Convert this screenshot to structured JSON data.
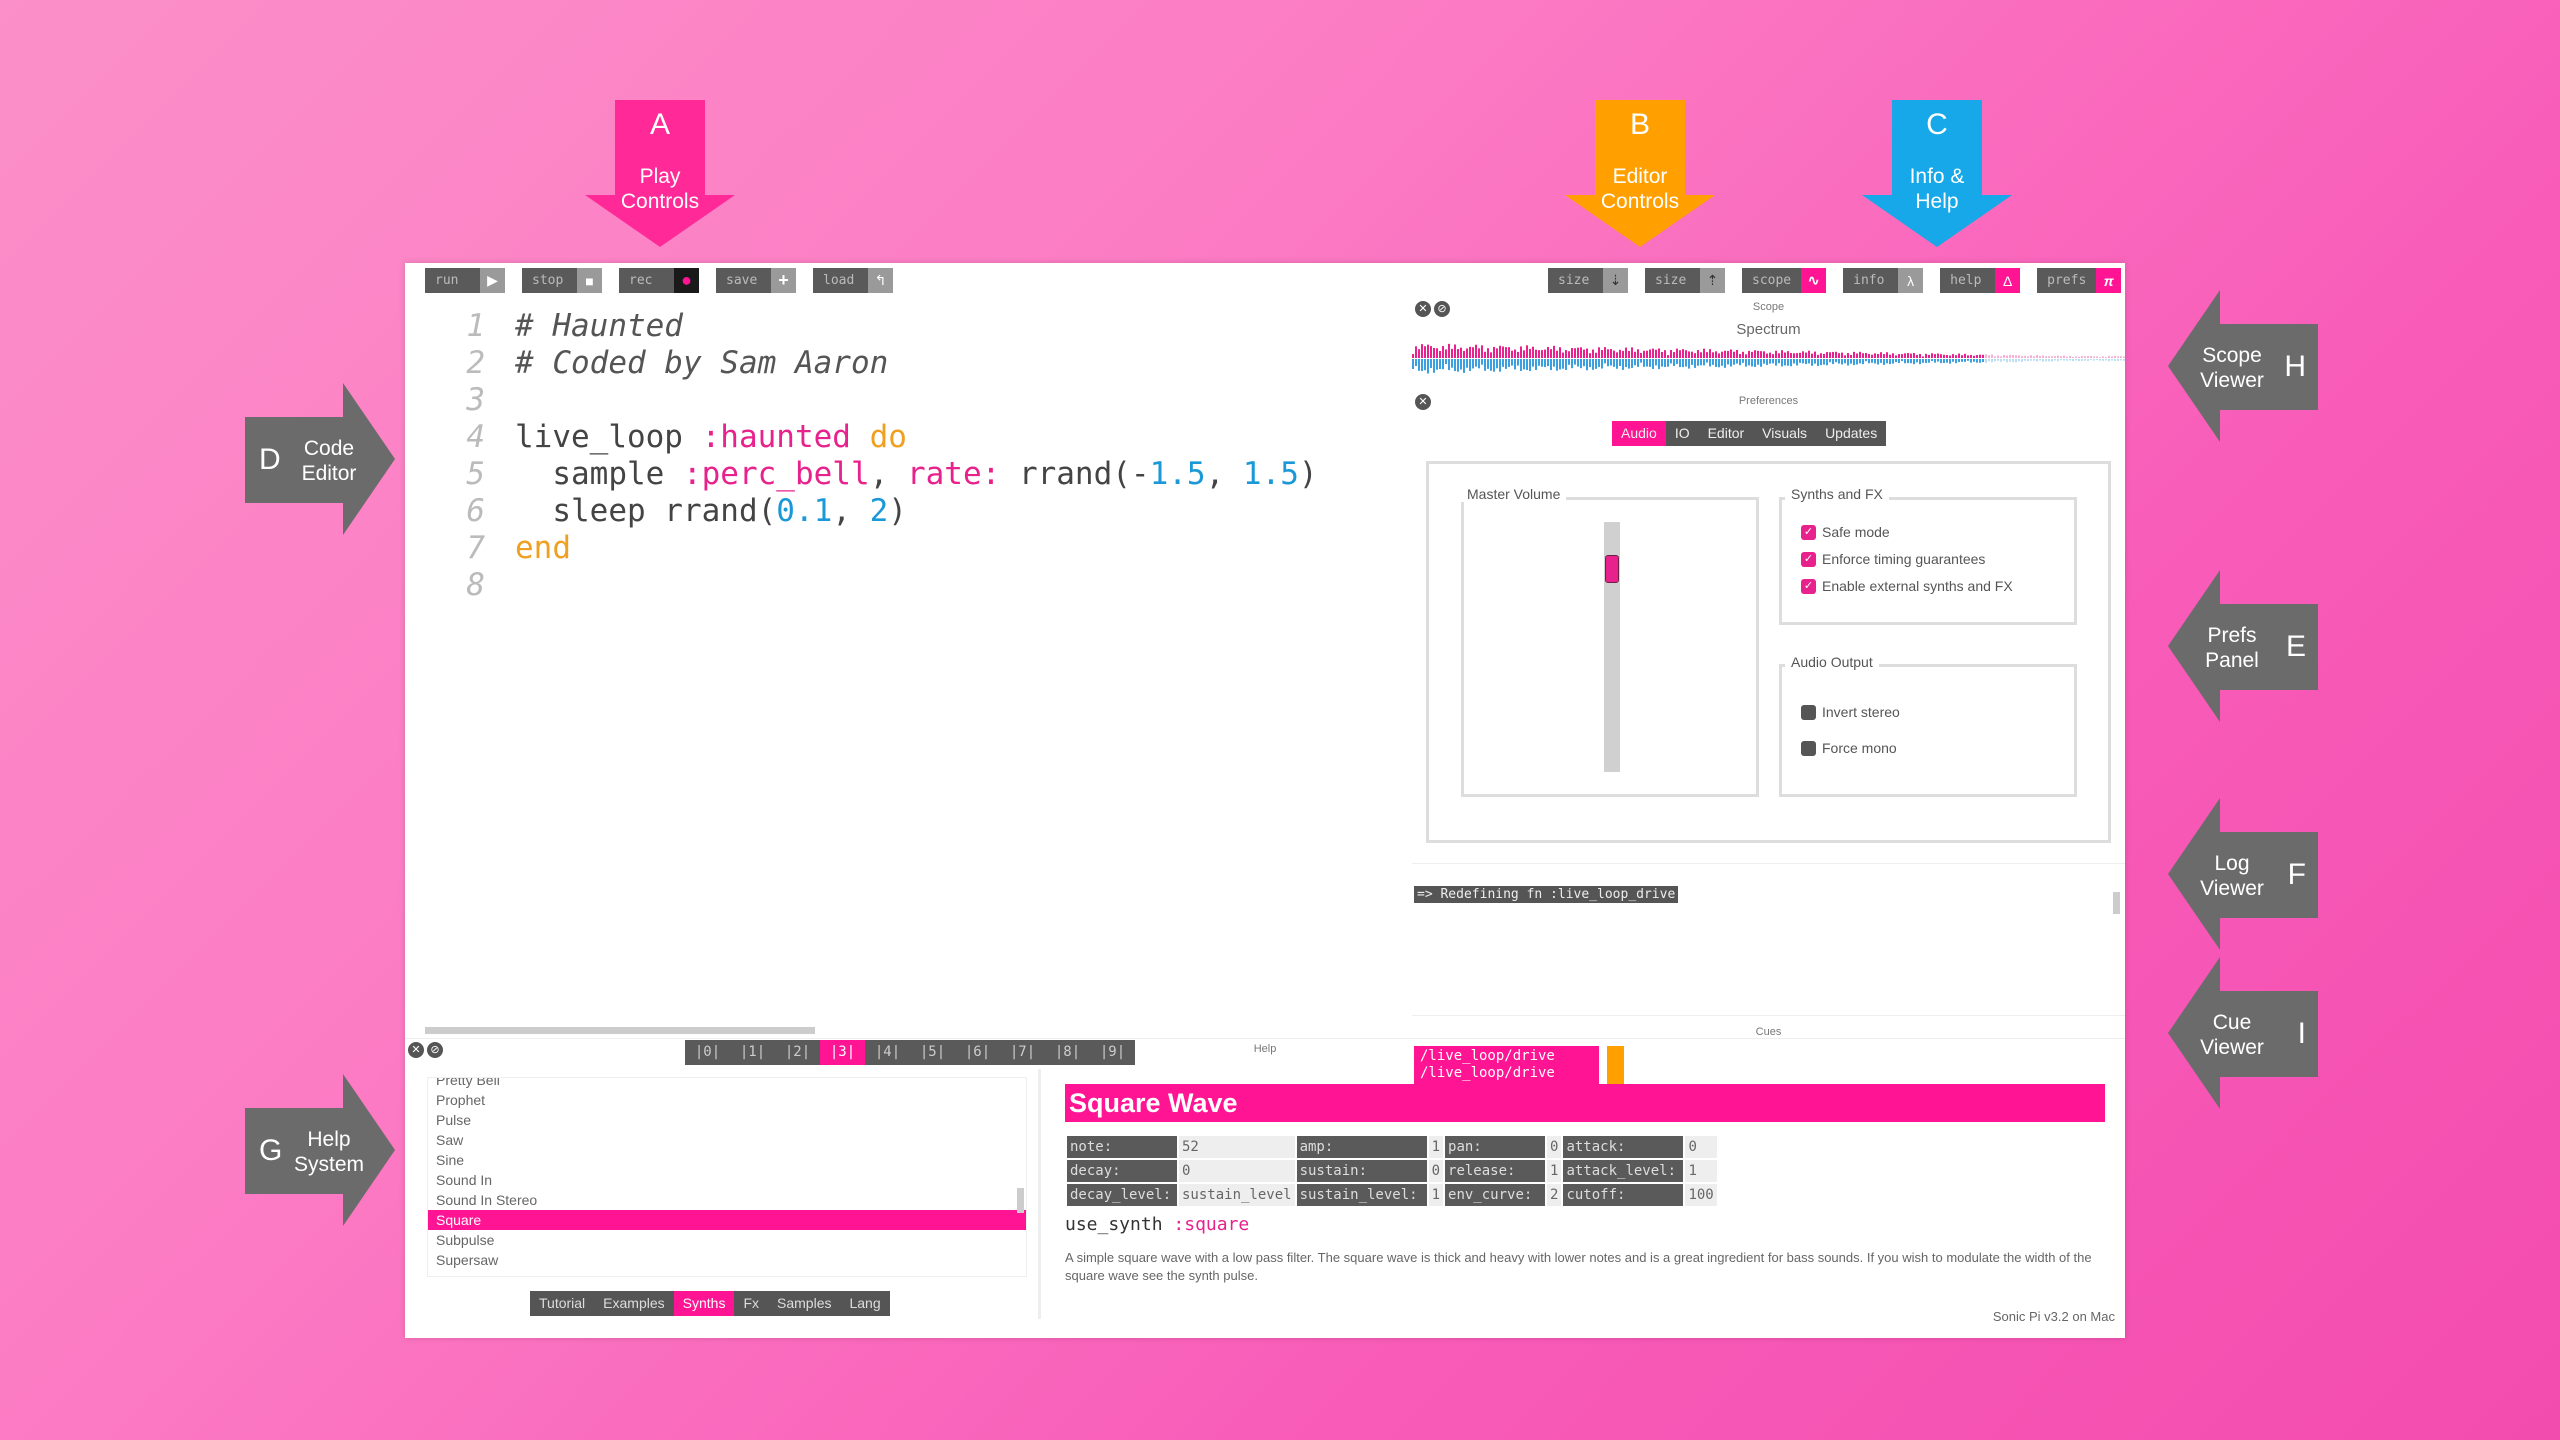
{
  "annotations": {
    "A": {
      "letter": "A",
      "label": "Play Controls",
      "color": "#ff2a98"
    },
    "B": {
      "letter": "B",
      "label": "Editor Controls",
      "color": "#ffa000"
    },
    "C": {
      "letter": "C",
      "label": "Info & Help",
      "color": "#16a8e8"
    },
    "D": {
      "letter": "D",
      "label": "Code Editor"
    },
    "E": {
      "letter": "E",
      "label": "Prefs Panel"
    },
    "F": {
      "letter": "F",
      "label": "Log Viewer"
    },
    "G": {
      "letter": "G",
      "label": "Help System"
    },
    "H": {
      "letter": "H",
      "label": "Scope Viewer"
    },
    "I": {
      "letter": "I",
      "label": "Cue Viewer"
    }
  },
  "toolbar": {
    "play": [
      {
        "label": "run",
        "icon": "play-icon",
        "glyph": "▶"
      },
      {
        "label": "stop",
        "icon": "stop-icon",
        "glyph": "■"
      },
      {
        "label": "rec",
        "icon": "record-icon",
        "glyph": "●"
      },
      {
        "label": "save",
        "icon": "plus-icon",
        "glyph": "+"
      },
      {
        "label": "load",
        "icon": "load-icon",
        "glyph": "↰"
      }
    ],
    "right": [
      {
        "label": "size",
        "icon": "size-down-icon",
        "glyph": "⇣"
      },
      {
        "label": "size",
        "icon": "size-up-icon",
        "glyph": "⇡"
      },
      {
        "label": "scope",
        "icon": "scope-icon",
        "glyph": "∿"
      },
      {
        "label": "info",
        "icon": "lambda-icon",
        "glyph": "λ"
      },
      {
        "label": "help",
        "icon": "delta-icon",
        "glyph": "Δ"
      },
      {
        "label": "prefs",
        "icon": "pi-icon",
        "glyph": "π"
      }
    ]
  },
  "editor": {
    "line_numbers": [
      "1",
      "2",
      "3",
      "4",
      "5",
      "6",
      "7",
      "8"
    ],
    "lines": {
      "l1": "# Haunted",
      "l2": "# Coded by Sam Aaron",
      "l4a": "live_loop ",
      "l4b": ":haunted",
      "l4c": " do",
      "l5a": "  sample ",
      "l5b": ":perc_bell",
      "l5c": ", ",
      "l5d": "rate:",
      "l5e": " rrand(-",
      "l5f": "1.5",
      "l5g": ", ",
      "l5h": "1.5",
      "l5i": ")",
      "l6a": "  sleep rrand(",
      "l6b": "0.1",
      "l6c": ", ",
      "l6d": "2",
      "l6e": ")",
      "l7": "end"
    },
    "buffers": [
      "|0|",
      "|1|",
      "|2|",
      "|3|",
      "|4|",
      "|5|",
      "|6|",
      "|7|",
      "|8|",
      "|9|"
    ],
    "active_buffer": 3
  },
  "scope": {
    "title": "Scope",
    "subtitle": "Spectrum"
  },
  "prefs": {
    "title": "Preferences",
    "tabs": [
      "Audio",
      "IO",
      "Editor",
      "Visuals",
      "Updates"
    ],
    "active_tab": "Audio",
    "master_volume_label": "Master Volume",
    "master_volume_level": 0.85,
    "synths_fx_label": "Synths and FX",
    "synths_fx": [
      {
        "label": "Safe mode",
        "checked": true
      },
      {
        "label": "Enforce timing guarantees",
        "checked": true
      },
      {
        "label": "Enable external synths and FX",
        "checked": true
      }
    ],
    "audio_output_label": "Audio Output",
    "audio_output": [
      {
        "label": "Invert stereo",
        "checked": false
      },
      {
        "label": "Force mono",
        "checked": false
      }
    ]
  },
  "log": {
    "entry": "=> Redefining fn :live_loop_drive"
  },
  "cues": {
    "title": "Cues",
    "items": [
      "/live_loop/drive",
      "/live_loop/drive"
    ]
  },
  "help": {
    "title": "Help",
    "list": [
      "Pretty Bell",
      "Prophet",
      "Pulse",
      "Saw",
      "Sine",
      "Sound In",
      "Sound In Stereo",
      "Square",
      "Subpulse",
      "Supersaw"
    ],
    "selected": "Square",
    "tabs": [
      "Tutorial",
      "Examples",
      "Synths",
      "Fx",
      "Samples",
      "Lang"
    ],
    "active_tab": "Synths",
    "doc_title": "Square Wave",
    "params": [
      [
        [
          "note:",
          "52"
        ],
        [
          "amp:",
          "1"
        ],
        [
          "pan:",
          "0"
        ],
        [
          "attack:",
          "0"
        ]
      ],
      [
        [
          "decay:",
          "0"
        ],
        [
          "sustain:",
          "0"
        ],
        [
          "release:",
          "1"
        ],
        [
          "attack_level:",
          "1"
        ]
      ],
      [
        [
          "decay_level:",
          "sustain_level"
        ],
        [
          "sustain_level:",
          "1"
        ],
        [
          "env_curve:",
          "2"
        ],
        [
          "cutoff:",
          "100"
        ]
      ]
    ],
    "usage_fn": "use_synth",
    "usage_arg": ":square",
    "description": "A simple square wave with a low pass filter. The square wave is thick and heavy with lower notes and is a great ingredient for bass sounds. If you wish to modulate the width of the square wave see the synth pulse.",
    "version": "Sonic Pi v3.2 on Mac"
  }
}
